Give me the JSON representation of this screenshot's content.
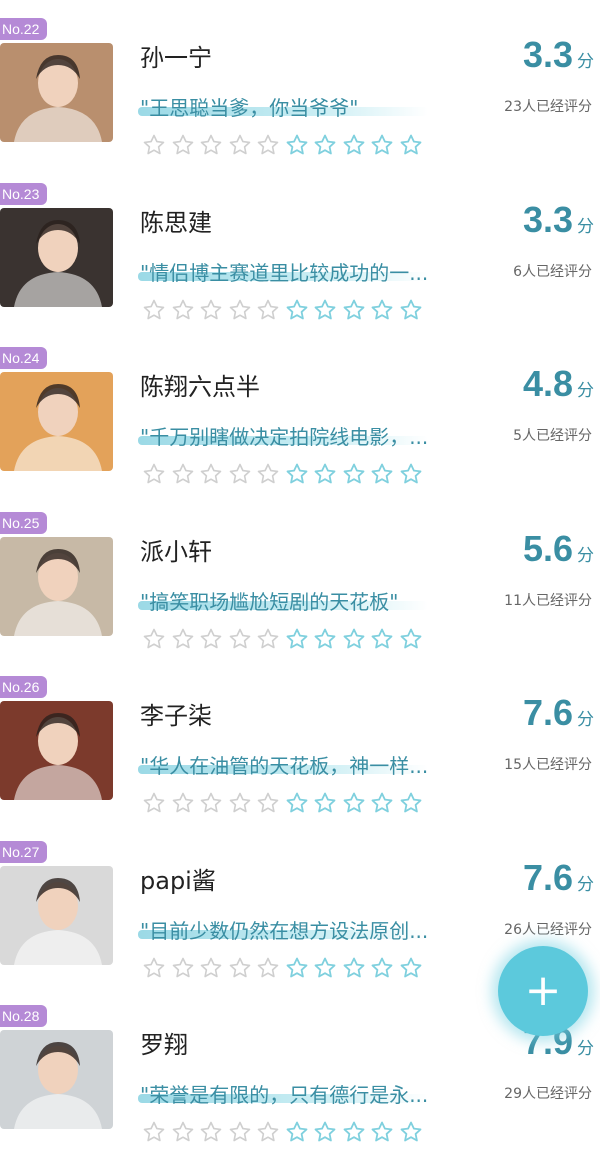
{
  "items": [
    {
      "rank": "No.22",
      "name": "孙一宁",
      "quote": "\"王思聪当爹，你当爷爷\"",
      "score": "3.3",
      "unit": "分",
      "count": "23人已经评分",
      "photo_color": "#b98f6e"
    },
    {
      "rank": "No.23",
      "name": "陈思建",
      "quote": "\"情侣博主赛道里比较成功的一...",
      "score": "3.3",
      "unit": "分",
      "count": "6人已经评分",
      "photo_color": "#3a3330"
    },
    {
      "rank": "No.24",
      "name": "陈翔六点半",
      "quote": "\"千万别瞎做决定拍院线电影，...",
      "score": "4.8",
      "unit": "分",
      "count": "5人已经评分",
      "photo_color": "#e3a25a"
    },
    {
      "rank": "No.25",
      "name": "派小轩",
      "quote": "\"搞笑职场尴尬短剧的天花板\"",
      "score": "5.6",
      "unit": "分",
      "count": "11人已经评分",
      "photo_color": "#c7b9a6"
    },
    {
      "rank": "No.26",
      "name": "李子柒",
      "quote": "\"华人在油管的天花板，神一样...",
      "score": "7.6",
      "unit": "分",
      "count": "15人已经评分",
      "photo_color": "#7c3a2c"
    },
    {
      "rank": "No.27",
      "name": "papi酱",
      "quote": "\"目前少数仍然在想方设法原创...",
      "score": "7.6",
      "unit": "分",
      "count": "26人已经评分",
      "photo_color": "#d9d9d9"
    },
    {
      "rank": "No.28",
      "name": "罗翔",
      "quote": "\"荣誉是有限的，只有德行是永...",
      "score": "7.9",
      "unit": "分",
      "count": "29人已经评分",
      "photo_color": "#cfd3d6"
    }
  ],
  "fab": {
    "label": "+"
  },
  "colors": {
    "accent": "#3a8ea3",
    "badge": "#b58ad6",
    "fab": "#5cc9dc",
    "star_gray": "#cfcfcf",
    "star_teal": "#7fd0de"
  }
}
